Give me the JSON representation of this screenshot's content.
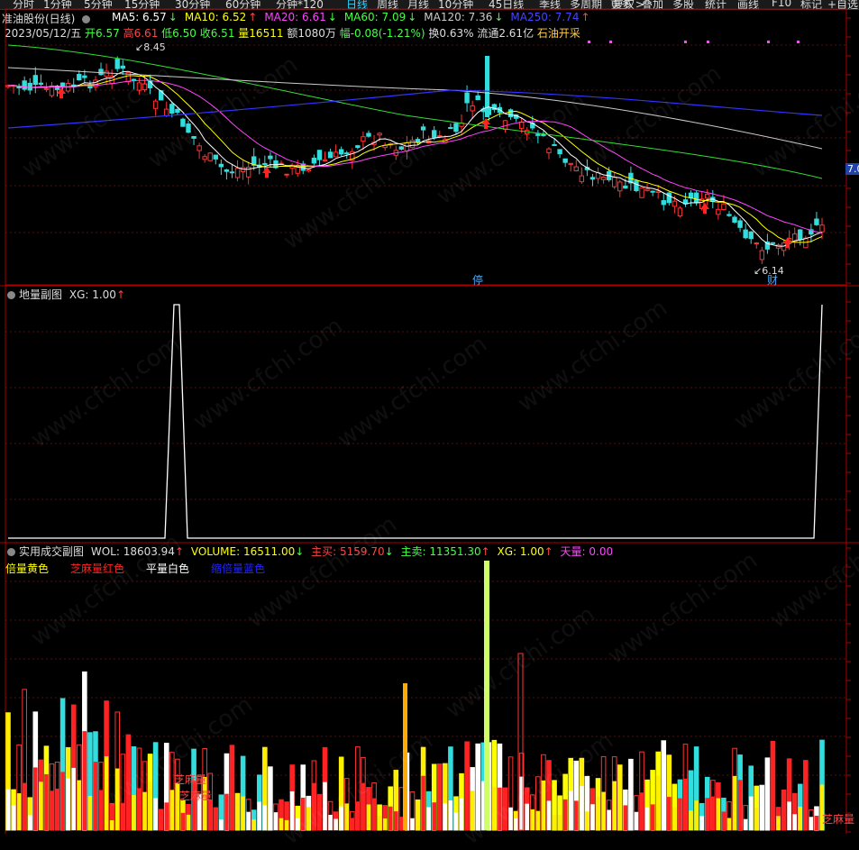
{
  "topbar": {
    "periods": [
      "分时",
      "1分钟",
      "5分钟",
      "15分钟",
      "30分钟",
      "60分钟",
      "分钟*120",
      "日线",
      "周线",
      "月线",
      "10分钟",
      "45日线",
      "季线",
      "多周期",
      "更多 >"
    ],
    "active_period": "日线",
    "tools": [
      "复权",
      "叠加",
      "多股",
      "统计",
      "画线",
      "F10",
      "标记",
      "+自选"
    ]
  },
  "price_panel": {
    "stock_title": "准油股份(日线)",
    "ma": [
      {
        "label": "MA5: 6.57",
        "arrow": "↓",
        "color": "#ffffff"
      },
      {
        "label": "MA10: 6.52",
        "arrow": "↑",
        "color": "#ffff00"
      },
      {
        "label": "MA20: 6.61",
        "arrow": "↓",
        "color": "#ff44ff"
      },
      {
        "label": "MA60: 7.09",
        "arrow": "↓",
        "color": "#44ff44"
      },
      {
        "label": "MA120: 7.36",
        "arrow": "↓",
        "color": "#cccccc"
      },
      {
        "label": "MA250: 7.74",
        "arrow": "↑",
        "color": "#4444ff"
      }
    ],
    "info": {
      "date": "2023/05/12/五",
      "open": "开6.57",
      "high": "高6.61",
      "low": "低6.50",
      "close": "收6.51",
      "volume": "量16511",
      "amount": "额1080万",
      "change": "幅-0.08(-1.21%)",
      "turnover": "换0.63%",
      "float": "流通2.61亿",
      "sector": "石油开采"
    },
    "high_mark": "8.45",
    "low_mark": "6.14",
    "stop_mark": "停",
    "fin_mark": "财",
    "right_label": "7.0"
  },
  "sub1": {
    "title": "地量副图",
    "xg": "XG: 1.00",
    "arrow": "↑"
  },
  "sub2": {
    "title": "实用成交副图",
    "wol": "WOL: 18603.94",
    "wol_arrow": "↑",
    "volume": "VOLUME: 16511.00",
    "volume_arrow": "↓",
    "zhumai": "主买: 5159.70",
    "zhumai_arrow": "↓",
    "zhumai2": "主卖: 11351.30",
    "zhumai2_arrow": "↑",
    "xg": "XG: 1.00",
    "xg_arrow": "↑",
    "tianliang": "天量: 0.00",
    "legend": [
      {
        "label": "倍量黄色",
        "color": "#ffff00"
      },
      {
        "label": "芝麻量红色",
        "color": "#ff2222"
      },
      {
        "label": "平量白色",
        "color": "#ffffff"
      },
      {
        "label": "缩倍量蓝色",
        "color": "#2222ff"
      }
    ],
    "zhima_labels": [
      "芝麻量",
      "芝麻量"
    ],
    "zhima_right": "芝麻量"
  },
  "watermark": "www.cfchi.com"
}
